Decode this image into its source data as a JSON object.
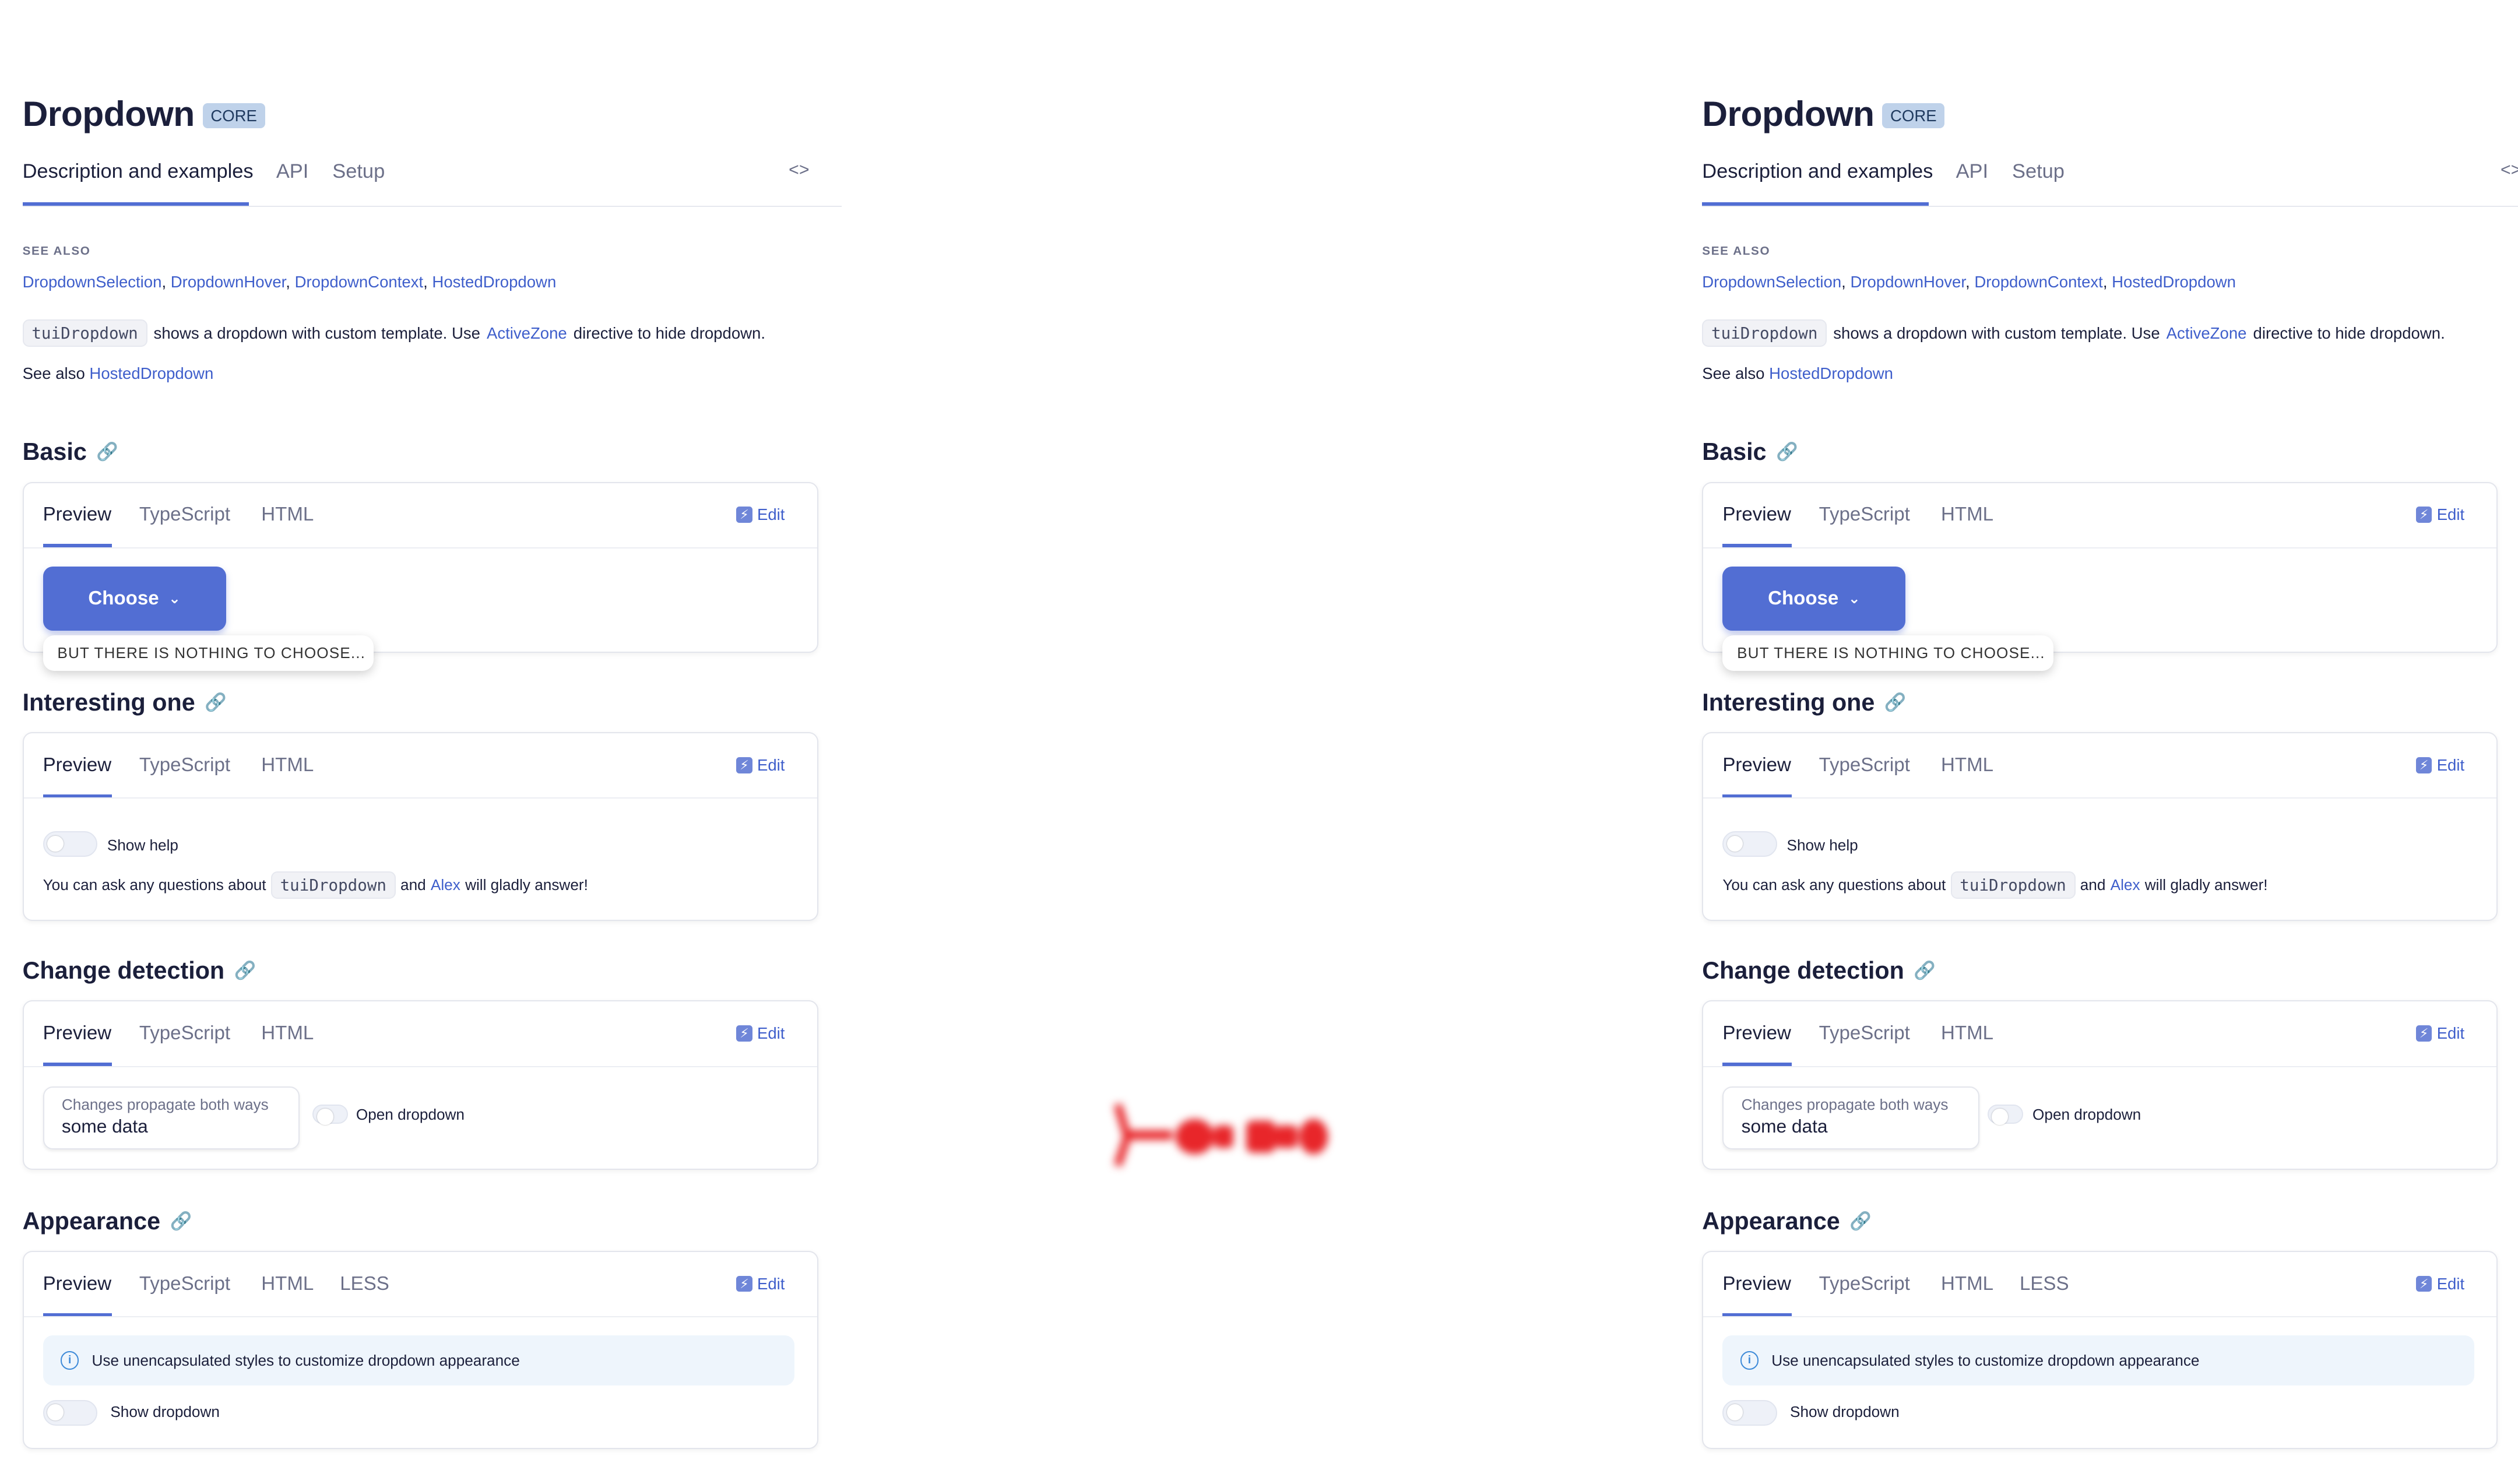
{
  "page": {
    "title": "Dropdown",
    "badge": "CORE",
    "tabs": [
      "Description and examples",
      "API",
      "Setup"
    ],
    "code_toggle": "<>"
  },
  "see_also": {
    "label": "SEE ALSO",
    "links": [
      "DropdownSelection",
      "DropdownHover",
      "DropdownContext",
      "HostedDropdown"
    ],
    "separator": ", "
  },
  "description": {
    "code": "tuiDropdown",
    "text_before": "shows a dropdown with custom template. Use",
    "link": "ActiveZone",
    "text_after": "directive to hide dropdown.",
    "see_also_prefix": "See also",
    "see_also_link": "HostedDropdown"
  },
  "card_tabs": {
    "preview": "Preview",
    "typescript": "TypeScript",
    "html": "HTML",
    "less": "LESS",
    "edit": "Edit"
  },
  "sections": {
    "basic": {
      "title": "Basic",
      "button": "Choose",
      "dropdown_text": "BUT THERE IS NOTHING TO CHOOSE..."
    },
    "interesting": {
      "title": "Interesting one",
      "toggle_label": "Show help",
      "text_before": "You can ask any questions about",
      "code": "tuiDropdown",
      "text_mid": "and",
      "link": "Alex",
      "text_after": "will gladly answer!"
    },
    "change_detection": {
      "title": "Change detection",
      "field_label": "Changes propagate both ways",
      "field_value": "some data",
      "toggle_label": "Open dropdown"
    },
    "appearance": {
      "title": "Appearance",
      "notification": "Use unencapsulated styles to customize dropdown appearance",
      "toggle_label": "Show dropdown"
    }
  },
  "colors": {
    "accent": "#526ed3",
    "link": "#3e5ecb",
    "badge_bg": "#bfd2ea",
    "notification_bg": "#eef5fc",
    "splash": "#e8262a"
  },
  "icons": {
    "anchor": "link-chain-icon",
    "chevron": "chevron-down-icon",
    "edit": "edit-lightning-icon",
    "info": "info-icon",
    "code": "code-brackets-icon"
  }
}
